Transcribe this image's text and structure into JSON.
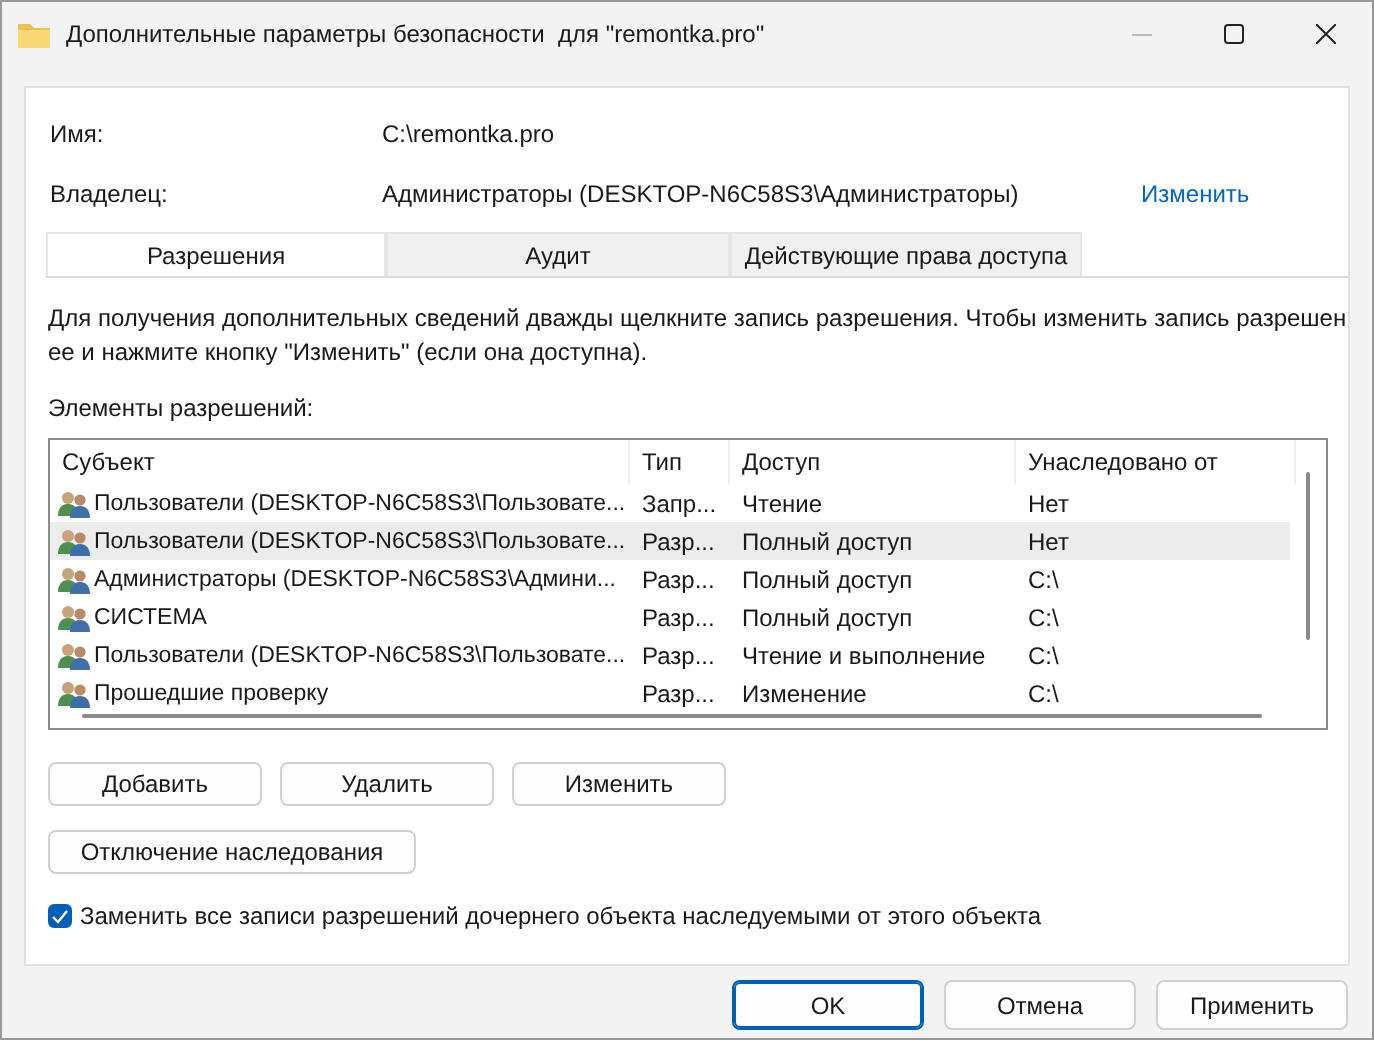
{
  "window": {
    "title": "Дополнительные параметры безопасности  для \"remontka.pro\""
  },
  "name_row": {
    "label": "Имя:",
    "value": "C:\\remontka.pro"
  },
  "owner_row": {
    "label": "Владелец:",
    "value": "Администраторы (DESKTOP-N6C58S3\\Администраторы)",
    "link": "Изменить"
  },
  "tabs": [
    {
      "label": "Разрешения",
      "selected": true
    },
    {
      "label": "Аудит",
      "selected": false
    },
    {
      "label": "Действующие права доступа",
      "selected": false
    }
  ],
  "description": "Для получения дополнительных сведений дважды щелкните запись разрешения. Чтобы изменить запись разрешен\nее и нажмите кнопку \"Изменить\" (если она доступна).",
  "list_label": "Элементы разрешений:",
  "table": {
    "columns": [
      "Субъект",
      "Тип",
      "Доступ",
      "Унаследовано от"
    ],
    "rows": [
      {
        "subject": "Пользователи (DESKTOP-N6C58S3\\Пользовате...",
        "type": "Запр...",
        "access": "Чтение",
        "inherited": "Нет",
        "selected": false
      },
      {
        "subject": "Пользователи (DESKTOP-N6C58S3\\Пользовате...",
        "type": "Разр...",
        "access": "Полный доступ",
        "inherited": "Нет",
        "selected": true
      },
      {
        "subject": "Администраторы (DESKTOP-N6C58S3\\Админи...",
        "type": "Разр...",
        "access": "Полный доступ",
        "inherited": "C:\\",
        "selected": false
      },
      {
        "subject": "СИСТЕМА",
        "type": "Разр...",
        "access": "Полный доступ",
        "inherited": "C:\\",
        "selected": false
      },
      {
        "subject": "Пользователи (DESKTOP-N6C58S3\\Пользовате...",
        "type": "Разр...",
        "access": "Чтение и выполнение",
        "inherited": "C:\\",
        "selected": false
      },
      {
        "subject": "Прошедшие проверку",
        "type": "Разр...",
        "access": "Изменение",
        "inherited": "C:\\",
        "selected": false
      }
    ]
  },
  "entry_buttons": [
    "Добавить",
    "Удалить",
    "Изменить"
  ],
  "inheritance_button": "Отключение наследования",
  "replace_checkbox": {
    "label": "Заменить все записи разрешений дочернего объекта наследуемыми от этого объекта",
    "checked": true
  },
  "dialog_buttons": [
    {
      "label": "OK",
      "default": true
    },
    {
      "label": "Отмена",
      "default": false
    },
    {
      "label": "Применить",
      "default": false
    }
  ]
}
